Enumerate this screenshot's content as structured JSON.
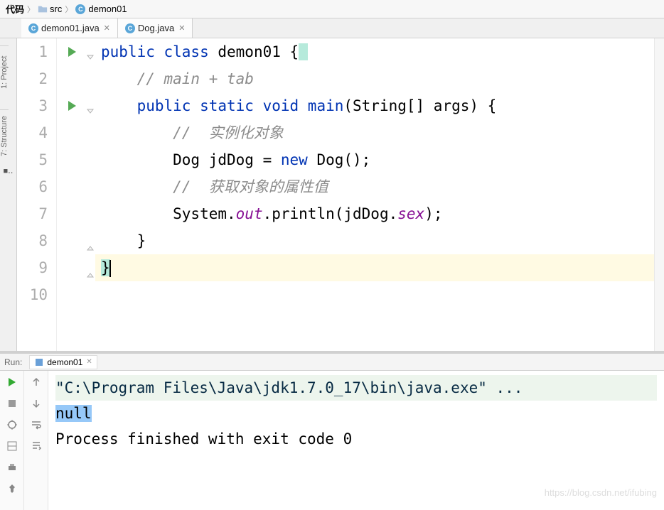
{
  "breadcrumb": {
    "items": [
      "代码",
      "src",
      "demon01"
    ]
  },
  "tabs": [
    {
      "label": "demon01.java",
      "active": true
    },
    {
      "label": "Dog.java",
      "active": false
    }
  ],
  "left_tools": {
    "project": "1: Project",
    "structure": "7: Structure"
  },
  "editor": {
    "lines": [
      "1",
      "2",
      "3",
      "4",
      "5",
      "6",
      "7",
      "8",
      "9",
      "10"
    ],
    "run_marker_lines": [
      1,
      3
    ],
    "fold_open_lines": [
      1,
      3
    ],
    "fold_close_lines": [
      8,
      9
    ],
    "caret_line": 9,
    "code": {
      "l1": {
        "pre": "public class ",
        "cls": "demon01",
        "post": " {"
      },
      "l2": "    // main + tab",
      "l3": {
        "a": "    public static void ",
        "b": "main",
        "c": "(String[] args) {"
      },
      "l4": "        //  实例化对象",
      "l5": {
        "a": "        Dog jdDog = ",
        "b": "new",
        "c": " Dog();"
      },
      "l6": "        //  获取对象的属性值",
      "l7": {
        "a": "        System.",
        "b": "out",
        "c": ".println(jdDog.",
        "d": "sex",
        "e": ");"
      },
      "l8": "    }",
      "l9": "}",
      "l10": ""
    }
  },
  "run": {
    "label": "Run:",
    "tab": "demon01",
    "cmd": "\"C:\\Program Files\\Java\\jdk1.7.0_17\\bin\\java.exe\" ...",
    "out1": "null",
    "blank": "",
    "exit": "Process finished with exit code 0",
    "watermark": "https://blog.csdn.net/ifubing"
  }
}
